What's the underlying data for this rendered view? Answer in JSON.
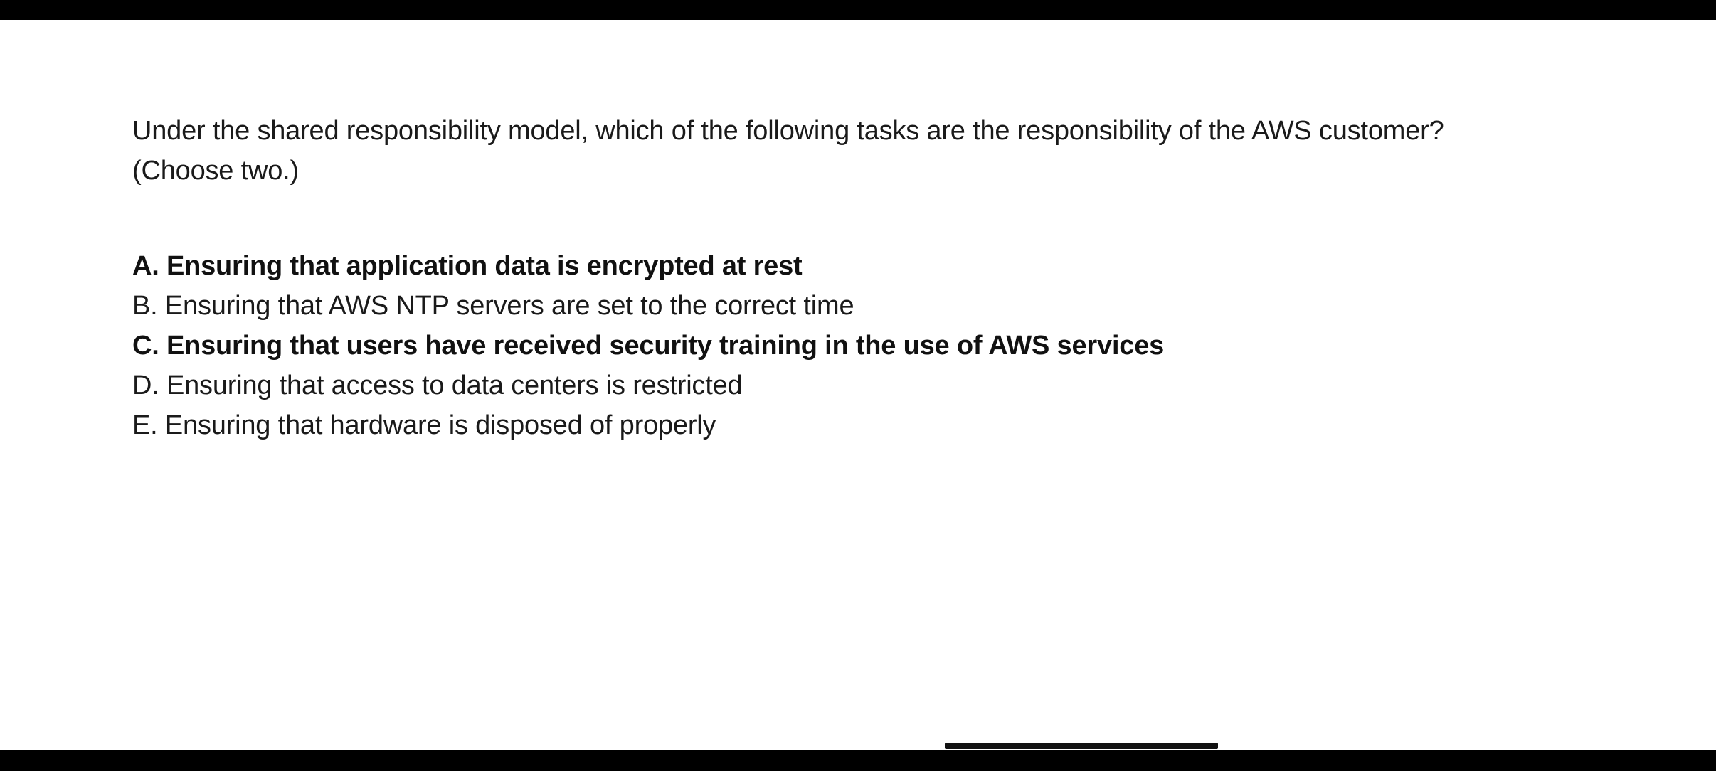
{
  "question": {
    "text": "Under the shared responsibility model, which of the following tasks are the responsibility of the AWS customer? (Choose two.)"
  },
  "options": [
    {
      "label": "A. Ensuring that application data is encrypted at rest",
      "highlighted": true
    },
    {
      "label": "B. Ensuring that AWS NTP servers are set to the correct time",
      "highlighted": false
    },
    {
      "label": "C. Ensuring that users have received security training in the use of AWS services",
      "highlighted": true
    },
    {
      "label": "D. Ensuring that access to data centers is restricted",
      "highlighted": false
    },
    {
      "label": "E. Ensuring that hardware is disposed of properly",
      "highlighted": false
    }
  ],
  "colors": {
    "background": "#ffffff",
    "frame": "#000000",
    "text": "#1a1a1a"
  }
}
